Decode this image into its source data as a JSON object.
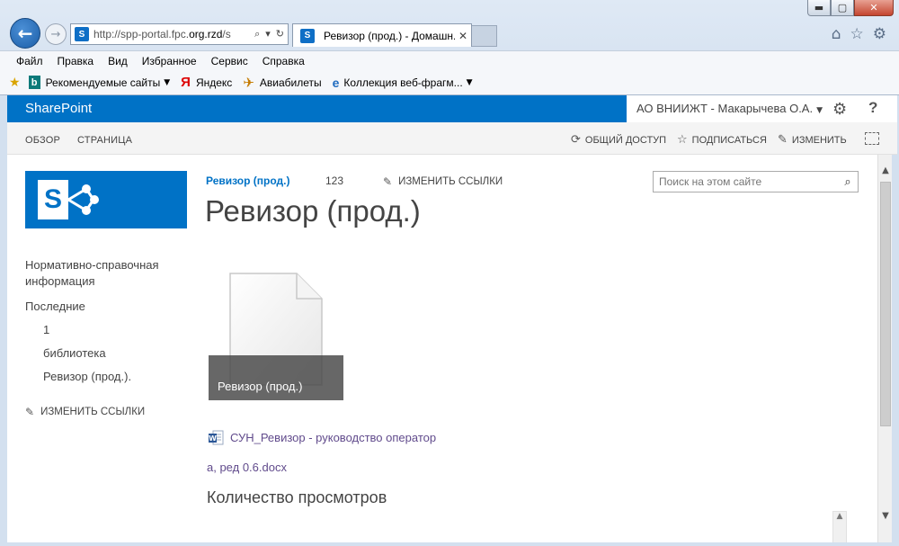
{
  "browser": {
    "url_prefix": "http://spp-portal.fpc.",
    "url_domain": "org.rzd",
    "url_suffix": "/s",
    "tab_title": "Ревизор (прод.) - Домашн...",
    "menu": [
      "Файл",
      "Правка",
      "Вид",
      "Избранное",
      "Сервис",
      "Справка"
    ],
    "favorites": {
      "recommended": "Рекомендуемые сайты",
      "yandex": "Яндекс",
      "avia": "Авиабилеты",
      "gallery": "Коллекция веб-фрагм..."
    },
    "window_controls": {
      "min": "▬",
      "max": "▢",
      "close": "✕"
    }
  },
  "suite": {
    "brand": "SharePoint",
    "user": "АО ВНИИЖТ - Макарычева О.А.",
    "help": "?"
  },
  "ribbon": {
    "tabs": [
      "ОБЗОР",
      "СТРАНИЦА"
    ],
    "share": "ОБЩИЙ ДОСТУП",
    "follow": "ПОДПИСАТЬСЯ",
    "edit": "ИЗМЕНИТЬ"
  },
  "site": {
    "top_link": "Ревизор (прод.)",
    "top_123": "123",
    "edit_links": "ИЗМЕНИТЬ ССЫЛКИ",
    "search_placeholder": "Поиск на этом сайте",
    "title": "Ревизор (прод.)"
  },
  "leftnav": {
    "items": [
      "Нормативно-справочная информация",
      "Последние"
    ],
    "sub": [
      "1",
      "библиотека",
      "Ревизор (прод.)."
    ],
    "edit_links": "ИЗМЕНИТЬ ССЫЛКИ"
  },
  "main": {
    "tile_caption": "Ревизор (прод.)",
    "doc_link_line1": "СУН_Ревизор - руководство оператор",
    "doc_link_line2": "а, ред 0.6.docx",
    "views_title": "Количество просмотров"
  }
}
